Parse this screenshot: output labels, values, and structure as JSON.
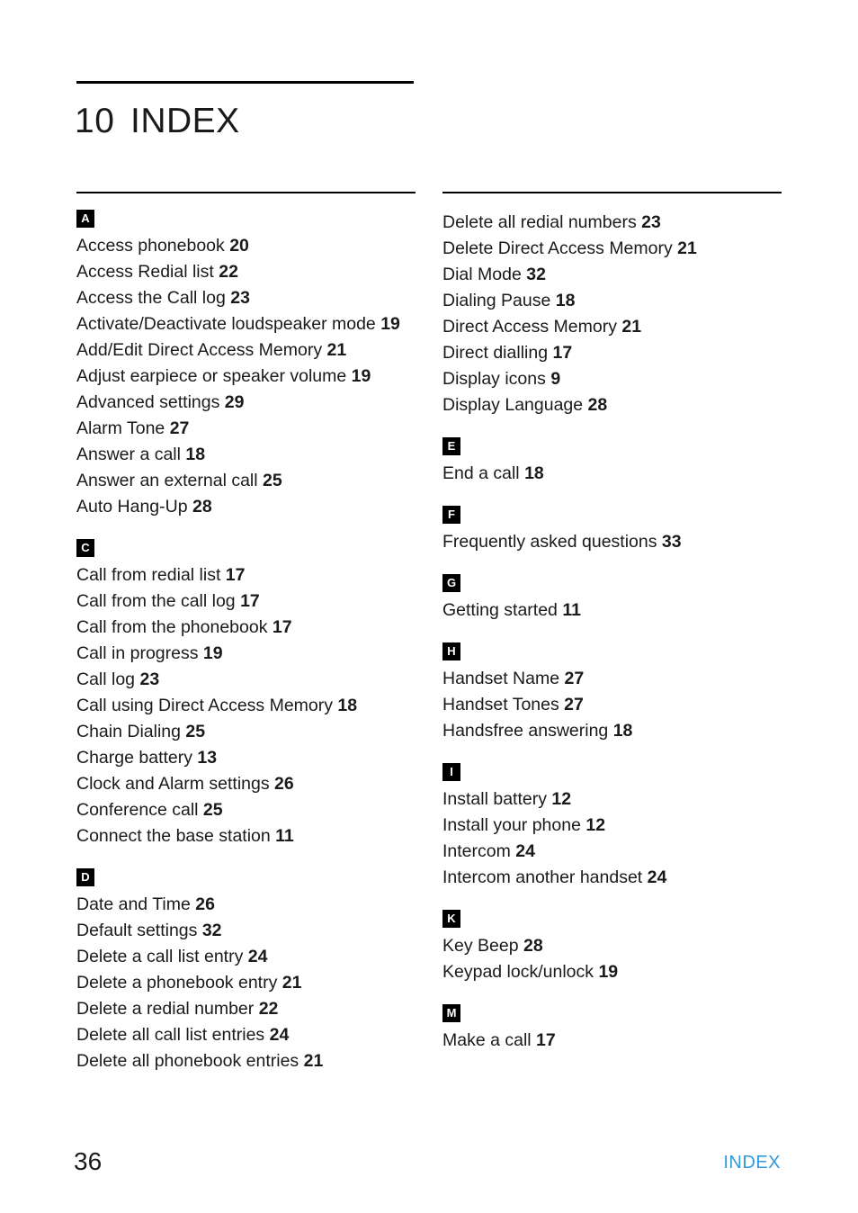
{
  "document": {
    "chapter_number": "10",
    "chapter_title": "INDEX"
  },
  "footer": {
    "page_number": "36",
    "label": "INDEX",
    "label_color": "#3399DD"
  },
  "columns": [
    {
      "sections": [
        {
          "letter": "A",
          "entries": [
            {
              "text": "Access phonebook",
              "page": "20"
            },
            {
              "text": "Access Redial list",
              "page": "22"
            },
            {
              "text": "Access the Call log",
              "page": "23"
            },
            {
              "text": "Activate/Deactivate loudspeaker mode",
              "page": "19"
            },
            {
              "text": "Add/Edit Direct Access Memory",
              "page": "21"
            },
            {
              "text": "Adjust earpiece or speaker volume",
              "page": "19"
            },
            {
              "text": "Advanced settings",
              "page": "29"
            },
            {
              "text": "Alarm Tone",
              "page": "27"
            },
            {
              "text": "Answer a call",
              "page": "18"
            },
            {
              "text": "Answer an external call",
              "page": "25"
            },
            {
              "text": "Auto Hang-Up",
              "page": "28"
            }
          ]
        },
        {
          "letter": "C",
          "entries": [
            {
              "text": "Call from redial list",
              "page": "17"
            },
            {
              "text": "Call from the call log",
              "page": "17"
            },
            {
              "text": "Call from the phonebook",
              "page": "17"
            },
            {
              "text": "Call in progress",
              "page": "19"
            },
            {
              "text": "Call log",
              "page": "23"
            },
            {
              "text": "Call using Direct Access Memory",
              "page": "18"
            },
            {
              "text": "Chain Dialing",
              "page": "25"
            },
            {
              "text": "Charge battery",
              "page": "13"
            },
            {
              "text": "Clock and Alarm settings",
              "page": "26"
            },
            {
              "text": "Conference call",
              "page": "25"
            },
            {
              "text": "Connect the base station",
              "page": "11"
            }
          ]
        },
        {
          "letter": "D",
          "entries": [
            {
              "text": "Date and Time",
              "page": "26"
            },
            {
              "text": "Default settings",
              "page": "32"
            },
            {
              "text": "Delete a call list entry",
              "page": "24"
            },
            {
              "text": "Delete a phonebook entry",
              "page": "21"
            },
            {
              "text": "Delete a redial number",
              "page": "22"
            },
            {
              "text": "Delete all call list entries",
              "page": "24"
            },
            {
              "text": "Delete all phonebook entries",
              "page": "21"
            }
          ]
        }
      ]
    },
    {
      "sections": [
        {
          "letter": "",
          "entries": [
            {
              "text": "Delete all redial numbers",
              "page": "23"
            },
            {
              "text": "Delete Direct Access Memory",
              "page": "21"
            },
            {
              "text": "Dial Mode",
              "page": "32"
            },
            {
              "text": "Dialing Pause",
              "page": "18"
            },
            {
              "text": "Direct Access Memory",
              "page": "21"
            },
            {
              "text": "Direct dialling",
              "page": "17"
            },
            {
              "text": "Display icons",
              "page": "9"
            },
            {
              "text": "Display Language",
              "page": "28"
            }
          ]
        },
        {
          "letter": "E",
          "entries": [
            {
              "text": "End a call",
              "page": "18"
            }
          ]
        },
        {
          "letter": "F",
          "entries": [
            {
              "text": "Frequently asked questions",
              "page": "33"
            }
          ]
        },
        {
          "letter": "G",
          "entries": [
            {
              "text": "Getting started",
              "page": "11"
            }
          ]
        },
        {
          "letter": "H",
          "entries": [
            {
              "text": "Handset Name",
              "page": "27"
            },
            {
              "text": "Handset Tones",
              "page": "27"
            },
            {
              "text": "Handsfree answering",
              "page": "18"
            }
          ]
        },
        {
          "letter": "I",
          "entries": [
            {
              "text": "Install battery",
              "page": "12"
            },
            {
              "text": "Install your phone",
              "page": "12"
            },
            {
              "text": "Intercom",
              "page": "24"
            },
            {
              "text": "Intercom another handset",
              "page": "24"
            }
          ]
        },
        {
          "letter": "K",
          "entries": [
            {
              "text": "Key Beep",
              "page": "28"
            },
            {
              "text": "Keypad lock/unlock",
              "page": "19"
            }
          ]
        },
        {
          "letter": "M",
          "entries": [
            {
              "text": "Make a call",
              "page": "17"
            }
          ]
        }
      ]
    }
  ]
}
